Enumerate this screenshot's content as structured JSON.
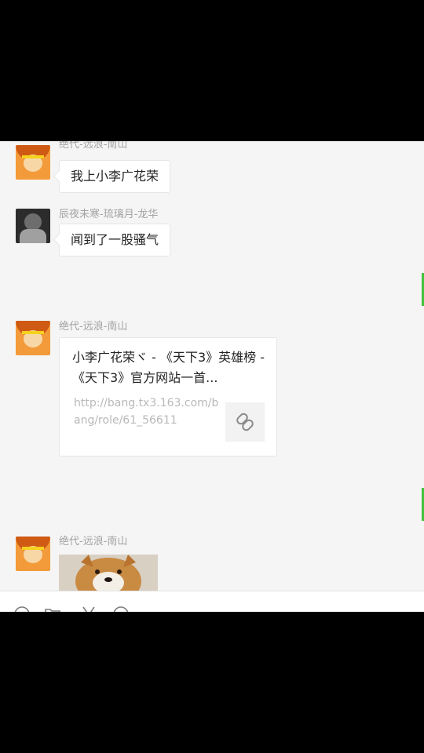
{
  "messages": [
    {
      "sender": "绝代-远浪-南山",
      "text": "我上小李广花荣"
    },
    {
      "sender": "辰夜未寒-琉璃月-龙华",
      "text": "闻到了一股骚气"
    },
    {
      "sender": "绝代-远浪-南山",
      "card": {
        "title": "小李广花荣ヾ - 《天下3》英雄榜 - 《天下3》官方网站一首...",
        "url": "http://bang.tx3.163.com/bang/role/61_56611"
      }
    },
    {
      "sender": "绝代-远浪-南山",
      "image": "shiba-dog-photo"
    }
  ],
  "toolbar": {
    "icons": [
      "emoji-icon",
      "folder-icon",
      "scissors-icon",
      "chat-bubble-icon"
    ]
  },
  "colors": {
    "chat_background": "#f5f5f5",
    "accent_green": "#43c23c",
    "sender_text": "#a2a2a2"
  }
}
